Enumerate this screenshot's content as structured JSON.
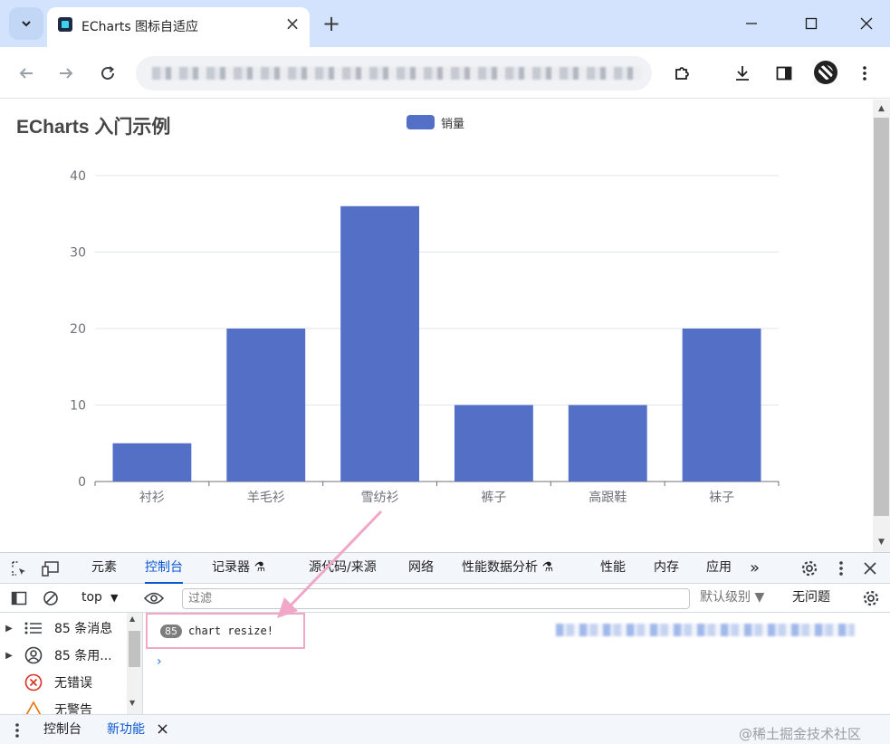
{
  "browser": {
    "tab_title": "ECharts 图标自适应",
    "tab_close": "×",
    "new_tab": "+"
  },
  "page": {
    "title": "ECharts 入门示例"
  },
  "chart_data": {
    "type": "bar",
    "title": "ECharts 入门示例",
    "categories": [
      "衬衫",
      "羊毛衫",
      "雪纺衫",
      "裤子",
      "高跟鞋",
      "袜子"
    ],
    "series": [
      {
        "name": "销量",
        "values": [
          5,
          20,
          36,
          10,
          10,
          20
        ],
        "color": "#5470c6"
      }
    ],
    "ylim": [
      0,
      40
    ],
    "yticks": [
      0,
      10,
      20,
      30,
      40
    ],
    "grid": true,
    "legend_position": "top-center"
  },
  "devtools": {
    "tabs": [
      "元素",
      "控制台",
      "记录器 ⚗",
      "源代码/来源",
      "网络",
      "性能数据分析 ⚗",
      "性能",
      "内存",
      "应用"
    ],
    "active_tab": "控制台",
    "more": "»",
    "context": "top",
    "filter_placeholder": "过滤",
    "level": "默认级别 ▼",
    "issues": "无问题",
    "sidebar": {
      "messages": "85 条消息",
      "user_messages": "85 条用...",
      "errors": "无错误",
      "warnings": "无警告"
    },
    "console_message": {
      "count": "85",
      "text": "chart resize!"
    },
    "prompt": "›",
    "drawer_tabs": [
      "控制台",
      "新功能"
    ],
    "drawer_close": "×"
  },
  "watermark": "@稀土掘金技术社区",
  "colors": {
    "bar": "#5470c6",
    "annotation": "#f0a7c8",
    "active_tab": "#0b57d0",
    "tabbar_bg": "#d3e3fd"
  }
}
